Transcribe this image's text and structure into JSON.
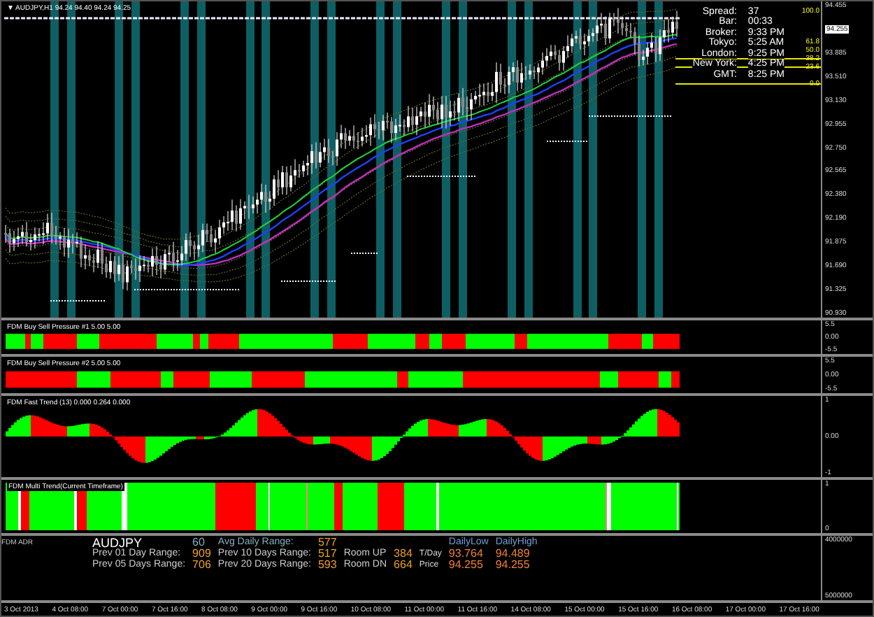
{
  "chart": {
    "title": "▼ AUDJPY,H1 94.24 94.40 94.24 94.25",
    "info": [
      {
        "label": "Spread:",
        "value": "37"
      },
      {
        "label": "Bar:",
        "value": "00:33"
      },
      {
        "label": "Broker:",
        "value": "9:33 PM"
      },
      {
        "label": "Tokyo:",
        "value": "5:25 AM"
      },
      {
        "label": "London:",
        "value": "9:25 PM"
      },
      {
        "label": "New York:",
        "value": "4:25 PM"
      },
      {
        "label": "GMT:",
        "value": "8:25 PM"
      }
    ],
    "fib_levels": [
      "100.0",
      "61.8",
      "50.0",
      "38.2",
      "23.6",
      "0.0"
    ],
    "price_axis": [
      {
        "text": "94.455",
        "kind": "tick"
      },
      {
        "text": "94.255",
        "kind": "current"
      },
      {
        "text": "93.885",
        "kind": "tick"
      },
      {
        "text": "93.510",
        "kind": "tick"
      },
      {
        "text": "93.130",
        "kind": "tick"
      },
      {
        "text": "92.955",
        "kind": "tick"
      },
      {
        "text": "92.750",
        "kind": "tick"
      },
      {
        "text": "92.565",
        "kind": "tick"
      },
      {
        "text": "92.380",
        "kind": "tick"
      },
      {
        "text": "92.190",
        "kind": "tick"
      },
      {
        "text": "91.875",
        "kind": "tick"
      },
      {
        "text": "91.690",
        "kind": "tick"
      },
      {
        "text": "91.325",
        "kind": "tick"
      },
      {
        "text": "90.930",
        "kind": "tick"
      }
    ]
  },
  "panes": [
    {
      "title": "FDM Buy Sell Pressure #1 5.00 5.00",
      "kind": "bars",
      "scale": [
        "5.5",
        "0.00",
        "-5.5"
      ]
    },
    {
      "title": "FDM Buy Sell Pressure #2 5.00 5.00",
      "kind": "bars",
      "scale": [
        "5.5",
        "0.00",
        "-5.5"
      ]
    },
    {
      "title": "FDM Fast Trend (13) 0.000 0.264 0.000",
      "kind": "histogram",
      "scale": [
        "1",
        "0.00",
        "-1"
      ]
    },
    {
      "title": "FDM Multi Trend(Current Timeframe)",
      "kind": "stripes",
      "scale": [
        "1",
        "0"
      ]
    }
  ],
  "adr": {
    "title": "FDM ADR",
    "symbol": "AUDJPY",
    "timeframe": "60",
    "avg_label": "Avg Daily Range:",
    "avg_value": "577",
    "rows": [
      {
        "label": "Prev 01 Day Range:",
        "value": "909",
        "label2": "Prev 10 Days Range:",
        "value2": "517",
        "label3": "Room UP",
        "value3": "384",
        "label4": "T/Day",
        "low": "93.764",
        "high": "94.489"
      },
      {
        "label": "Prev 05 Days Range:",
        "value": "706",
        "label2": "Prev 20 Days Range:",
        "value2": "593",
        "label3": "Room DN",
        "value3": "664",
        "label4": "Price",
        "low": "94.255",
        "high": "94.255"
      }
    ],
    "low_header": "DailyLow",
    "high_header": "DailyHigh",
    "scale": [
      "4000000",
      "5000000"
    ]
  },
  "time_axis": [
    "3 Oct 2013",
    "4 Oct 08:00",
    "7 Oct 00:00",
    "7 Oct 16:00",
    "8 Oct 08:00",
    "9 Oct 00:00",
    "9 Oct 16:00",
    "10 Oct 08:00",
    "11 Oct 00:00",
    "11 Oct 16:00",
    "14 Oct 08:00",
    "15 Oct 00:00",
    "15 Oct 16:00",
    "16 Oct 08:00",
    "17 Oct 00:00",
    "17 Oct 16:00"
  ]
}
